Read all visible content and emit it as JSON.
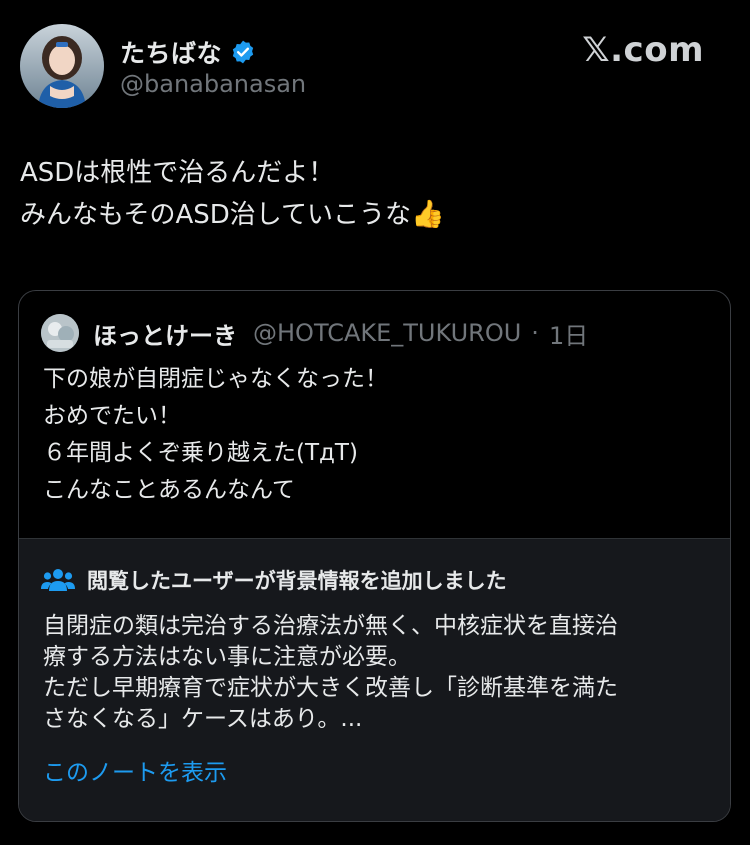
{
  "author": {
    "display_name": "たちばな",
    "handle": "@banabanasan",
    "verified": true
  },
  "site_label": "𝕏.com",
  "tweet": {
    "lines": [
      "ASDは根性で治るんだよ！",
      "みんなもそのASD治していこうな"
    ],
    "emoji": "👍"
  },
  "quote": {
    "display_name": "ほっとけーき",
    "handle": "@HOTCAKE_TUKUROU",
    "separator": "·",
    "time": "1日",
    "lines": [
      "下の娘が自閉症じゃなくなった！",
      "おめでたい！",
      "６年間よくぞ乗り越えた(TдT)",
      "こんなことあるんなんて"
    ]
  },
  "community_note": {
    "icon": "people-icon",
    "title": "閲覧したユーザーが背景情報を追加しました",
    "lines": [
      "自閉症の類は完治する治療法が無く、中核症状を直接治",
      "療する方法はない事に注意が必要。",
      "ただし早期療育で症状が大きく改善し「診断基準を満た",
      "さなくなる」ケースはあり。..."
    ],
    "link_label": "このノートを表示"
  },
  "colors": {
    "background": "#000000",
    "primary_text": "#e7e9ea",
    "secondary_text": "#71767b",
    "accent_blue": "#1d9bf0",
    "card_border": "#3a3d42",
    "note_background": "#16181c"
  }
}
